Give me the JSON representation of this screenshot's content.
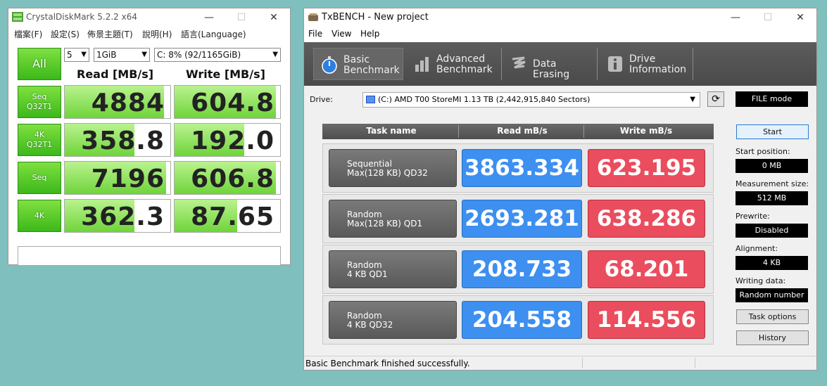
{
  "cdm": {
    "title": "CrystalDiskMark 5.2.2 x64",
    "menu": [
      "檔案(F)",
      "設定(S)",
      "佈景主題(T)",
      "說明(H)",
      "語言(Language)"
    ],
    "all_label": "All",
    "count": "5",
    "size": "1GiB",
    "drive": "C: 8% (92/1165GiB)",
    "read_header": "Read [MB/s]",
    "write_header": "Write [MB/s]",
    "rows": [
      {
        "label1": "Seq",
        "label2": "Q32T1",
        "read": "4884",
        "write": "604.8"
      },
      {
        "label1": "4K",
        "label2": "Q32T1",
        "read": "358.8",
        "write": "192.0"
      },
      {
        "label1": "Seq",
        "label2": "",
        "read": "7196",
        "write": "606.8"
      },
      {
        "label1": "4K",
        "label2": "",
        "read": "362.3",
        "write": "87.65"
      }
    ],
    "comment": ""
  },
  "tx": {
    "title": "TxBENCH - New project",
    "menu": [
      "File",
      "View",
      "Help"
    ],
    "tabs": [
      {
        "line1": "Basic",
        "line2": "Benchmark",
        "icon": "stopwatch-icon"
      },
      {
        "line1": "Advanced",
        "line2": "Benchmark",
        "icon": "bar-chart-icon"
      },
      {
        "line1": "Data Erasing",
        "line2": "",
        "icon": "eraser-icon"
      },
      {
        "line1": "Drive",
        "line2": "Information",
        "icon": "info-icon"
      }
    ],
    "drive_label": "Drive:",
    "drive_value": "(C:) AMD T00 StoreMI  1.13 TB (2,442,915,840 Sectors)",
    "file_mode": "FILE mode",
    "col_task": "Task name",
    "col_read": "Read mB/s",
    "col_write": "Write mB/s",
    "rows": [
      {
        "line1": "Sequential",
        "line2": "Max(128 KB) QD32",
        "read": "3863.334",
        "write": "623.195"
      },
      {
        "line1": "Random",
        "line2": "Max(128 KB) QD1",
        "read": "2693.281",
        "write": "638.286"
      },
      {
        "line1": "Random",
        "line2": "4 KB QD1",
        "read": "208.733",
        "write": "68.201"
      },
      {
        "line1": "Random",
        "line2": "4 KB QD32",
        "read": "204.558",
        "write": "114.556"
      }
    ],
    "start_label": "Start",
    "start_position_label": "Start position:",
    "start_position_value": "0 MB",
    "measurement_label": "Measurement size:",
    "measurement_value": "512 MB",
    "prewrite_label": "Prewrite:",
    "prewrite_value": "Disabled",
    "alignment_label": "Alignment:",
    "alignment_value": "4 KB",
    "writing_label": "Writing data:",
    "writing_value": "Random number",
    "task_options_label": "Task options",
    "history_label": "History",
    "status": "Basic Benchmark finished successfully."
  },
  "colors": {
    "desktop": "#7fbfbd",
    "read": "#3d8ff0",
    "write": "#ea4d5d",
    "cdm_green": "#3cb81a"
  }
}
